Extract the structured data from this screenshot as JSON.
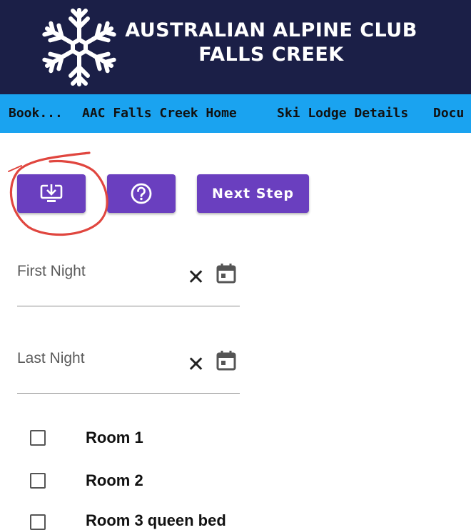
{
  "header": {
    "title_line1": "AUSTRALIAN ALPINE CLUB",
    "title_line2": "FALLS CREEK",
    "logo_icon": "snowflake-icon"
  },
  "nav": {
    "items": [
      "Book...",
      "AAC Falls Creek Home",
      "Ski Lodge Details",
      "Docu"
    ]
  },
  "toolbar": {
    "download_icon": "download-to-device-icon",
    "help_icon": "help-circle-icon",
    "next_step_label": "Next Step"
  },
  "form": {
    "first_night_label": "First Night",
    "last_night_label": "Last Night",
    "clear_symbol": "✕",
    "calendar_icon": "calendar-icon"
  },
  "rooms": [
    {
      "label": "Room 1",
      "checked": false
    },
    {
      "label": "Room 2",
      "checked": false
    },
    {
      "label": "Room 3 queen bed",
      "checked": false
    }
  ],
  "colors": {
    "header_bg": "#1b1f47",
    "nav_bg": "#1aa3f0",
    "button_bg": "#6a3fbf",
    "annotation_red": "#e0463f"
  }
}
